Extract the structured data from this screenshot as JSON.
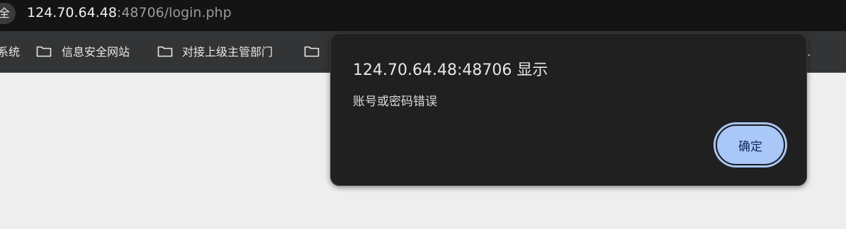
{
  "address_bar": {
    "site_info_label": "全",
    "url_host": "124.70.64.48",
    "url_rest": ":48706/login.php"
  },
  "bookmarks_bar": {
    "items": [
      {
        "label": "系统"
      },
      {
        "label": "信息安全网站"
      },
      {
        "label": "对接上级主管部门"
      },
      {
        "label": ""
      }
    ],
    "overflow_label": ".."
  },
  "alert_dialog": {
    "title": "124.70.64.48:48706 显示",
    "message": "账号或密码错误",
    "ok_label": "确定"
  }
}
